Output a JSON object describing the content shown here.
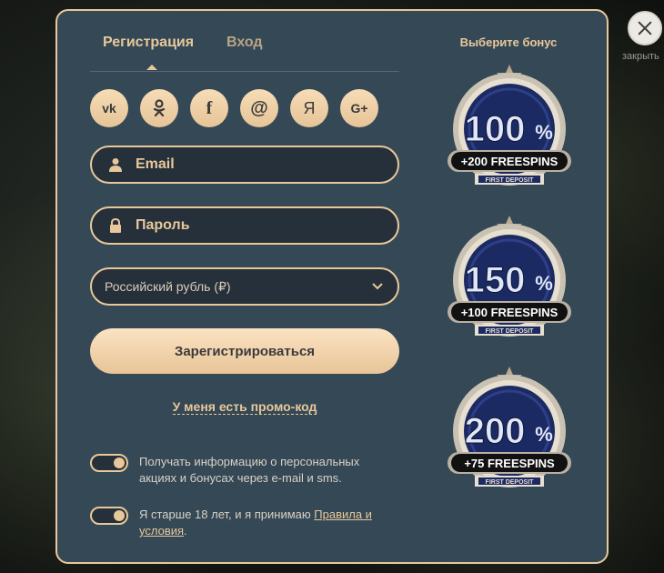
{
  "close": {
    "label": "закрыть"
  },
  "tabs": [
    {
      "label": "Регистрация"
    },
    {
      "label": "Вход"
    }
  ],
  "socials": [
    {
      "name": "vk",
      "glyph": "vk"
    },
    {
      "name": "odnoklassniki",
      "glyph": "ok"
    },
    {
      "name": "facebook",
      "glyph": "f"
    },
    {
      "name": "mail-ru",
      "glyph": "@"
    },
    {
      "name": "yandex",
      "glyph": "Я"
    },
    {
      "name": "google-plus",
      "glyph": "G+"
    }
  ],
  "form": {
    "email_placeholder": "Email",
    "password_placeholder": "Пароль",
    "currency": "Российский рубль (₽)",
    "submit_label": "Зарегистрироваться",
    "promo_link": "У меня есть промо-код"
  },
  "toggles": [
    {
      "text": "Получать информацию о персональных акциях и бонусах через e-mail и sms.",
      "on": true
    },
    {
      "text_before": "Я старше 18 лет, и я принимаю ",
      "link": "Правила и условия",
      "text_after": ".",
      "on": true
    }
  ],
  "bonus": {
    "title": "Выберите бонус",
    "items": [
      {
        "percent": "100",
        "freespins": "+200 FREESPINS",
        "caption": "FIRST DEPOSIT"
      },
      {
        "percent": "150",
        "freespins": "+100 FREESPINS",
        "caption": "FIRST DEPOSIT"
      },
      {
        "percent": "200",
        "freespins": "+75 FREESPINS",
        "caption": "FIRST DEPOSIT"
      }
    ]
  },
  "colors": {
    "accent": "#e8c89a",
    "panel": "#354856",
    "field": "#26303b",
    "badge_navy": "#1c2a63"
  }
}
